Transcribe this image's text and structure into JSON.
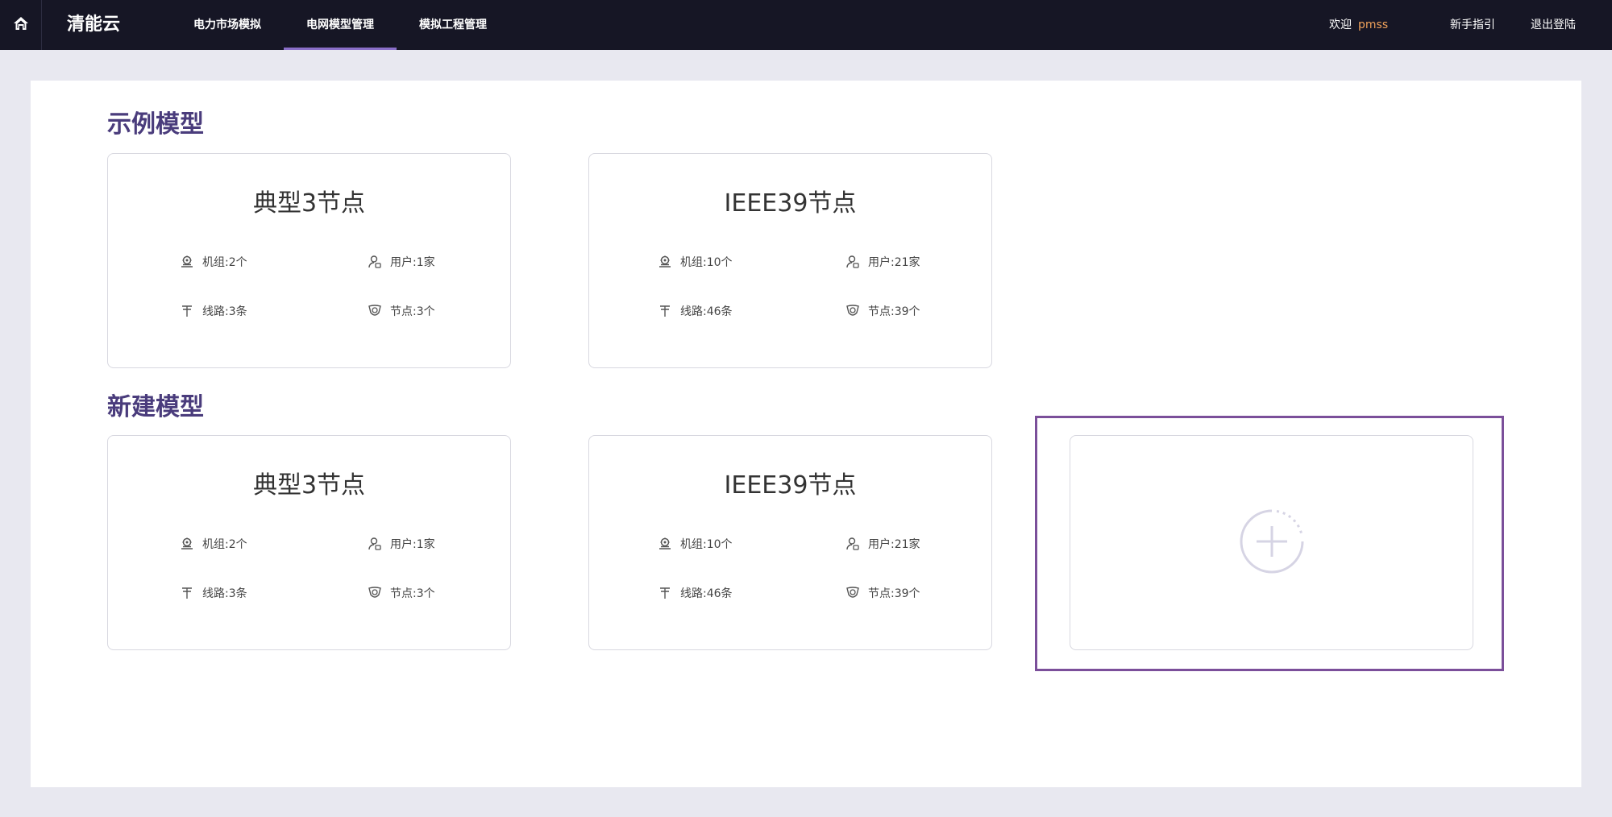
{
  "nav": {
    "brand": "清能云",
    "tabs": [
      {
        "label": "电力市场模拟"
      },
      {
        "label": "电网模型管理"
      },
      {
        "label": "模拟工程管理"
      }
    ],
    "welcome_label": "欢迎",
    "username": "pmss",
    "guide_label": "新手指引",
    "logout_label": "退出登陆"
  },
  "sections": {
    "examples": {
      "title": "示例模型",
      "cards": [
        {
          "title": "典型3节点",
          "units": "机组:2个",
          "users": "用户:1家",
          "lines": "线路:3条",
          "nodes": "节点:3个"
        },
        {
          "title": "IEEE39节点",
          "units": "机组:10个",
          "users": "用户:21家",
          "lines": "线路:46条",
          "nodes": "节点:39个"
        }
      ]
    },
    "created": {
      "title": "新建模型",
      "cards": [
        {
          "title": "典型3节点",
          "units": "机组:2个",
          "users": "用户:1家",
          "lines": "线路:3条",
          "nodes": "节点:3个"
        },
        {
          "title": "IEEE39节点",
          "units": "机组:10个",
          "users": "用户:21家",
          "lines": "线路:46条",
          "nodes": "节点:39个"
        }
      ]
    }
  },
  "icons": {
    "home": "home-icon",
    "unit": "generator-icon",
    "user": "user-icon",
    "line": "power-line-icon",
    "node": "node-icon",
    "add": "add-circle-icon"
  },
  "colors": {
    "topbar": "#161625",
    "accent": "#8a6fc9",
    "section_title": "#4a3c7c",
    "username": "#f0a25a",
    "highlight": "#7b4f9a"
  }
}
